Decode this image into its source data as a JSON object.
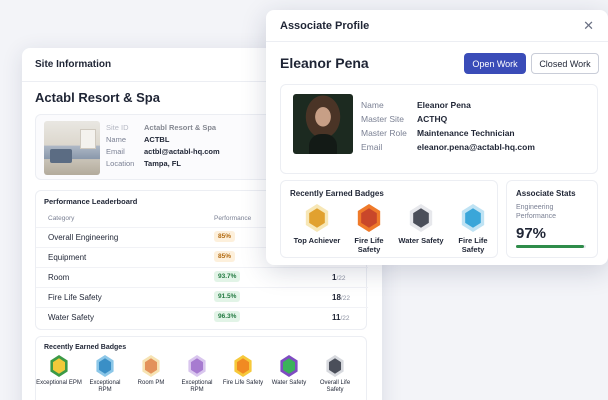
{
  "site": {
    "header": "Site Information",
    "title": "Actabl Resort & Spa",
    "info": [
      {
        "key": "Site ID",
        "value": "Actabl Resort & Spa"
      },
      {
        "key": "Name",
        "value": "ACTBL"
      },
      {
        "key": "Email",
        "value": "actbl@actabl-hq.com"
      },
      {
        "key": "Location",
        "value": "Tampa, FL"
      }
    ],
    "leaderboard": {
      "title": "Performance Leaderboard",
      "col_category": "Category",
      "col_performance": "Performance",
      "rows": [
        {
          "category": "Overall Engineering",
          "performance": "85%",
          "status": "amber",
          "rank": "",
          "total": ""
        },
        {
          "category": "Equipment",
          "performance": "85%",
          "status": "amber",
          "rank": "",
          "total": ""
        },
        {
          "category": "Room",
          "performance": "93.7%",
          "status": "green",
          "rank": "1",
          "total": "/22"
        },
        {
          "category": "Fire Life Safety",
          "performance": "91.5%",
          "status": "green",
          "rank": "18",
          "total": "/22"
        },
        {
          "category": "Water Safety",
          "performance": "96.3%",
          "status": "green",
          "rank": "11",
          "total": "/22"
        }
      ]
    },
    "badges": {
      "title": "Recently Earned Badges",
      "items": [
        {
          "label": "Exceptional EPM",
          "icon": "gear-badge-icon",
          "color": "#3c9a46",
          "inner": "#f1c93a"
        },
        {
          "label": "Exceptional RPM",
          "icon": "gem-badge-icon",
          "color": "#8cc7e8",
          "inner": "#3a8fc6"
        },
        {
          "label": "Room PM",
          "icon": "room-badge-icon",
          "color": "#f6e3b3",
          "inner": "#e3925b"
        },
        {
          "label": "Exceptional RPM",
          "icon": "cake-badge-icon",
          "color": "#d9c6ee",
          "inner": "#a77bd0"
        },
        {
          "label": "Fire Life Safety",
          "icon": "flame-badge-icon",
          "color": "#f6c93b",
          "inner": "#f18a22"
        },
        {
          "label": "Water Safety",
          "icon": "check-badge-icon",
          "color": "#7f4cc2",
          "inner": "#3bb25a"
        },
        {
          "label": "Overall Life Safety",
          "icon": "bee-badge-icon",
          "color": "#d7d9de",
          "inner": "#4b4f5a"
        }
      ]
    }
  },
  "profile": {
    "header": "Associate Profile",
    "close_glyph": "✕",
    "name": "Eleanor Pena",
    "buttons": {
      "open_work": "Open Work",
      "closed_work": "Closed Work"
    },
    "info": [
      {
        "key": "Name",
        "value": "Eleanor Pena"
      },
      {
        "key": "Master Site",
        "value": "ACTHQ"
      },
      {
        "key": "Master Role",
        "value": "Maintenance Technician"
      },
      {
        "key": "Email",
        "value": "eleanor.pena@actabl-hq.com"
      }
    ],
    "badges": {
      "title": "Recently Earned Badges",
      "items": [
        {
          "label": "Top Achiever",
          "icon": "trophy-badge-icon",
          "color": "#f7e7b6",
          "inner": "#e1a12f"
        },
        {
          "label": "Fire Life Safety",
          "icon": "fire-badge-icon",
          "color": "#ef7a2a",
          "inner": "#c9472a"
        },
        {
          "label": "Water Safety",
          "icon": "bee-badge-icon",
          "color": "#e7e8ec",
          "inner": "#4b4f5a"
        },
        {
          "label": "Fire Life Safety",
          "icon": "diamond-badge-icon",
          "color": "#bfe3f4",
          "inner": "#3aa6d9"
        }
      ]
    },
    "stats": {
      "title": "Associate Stats",
      "label": "Engineering Performance",
      "value": "97%",
      "progress": 0.97,
      "bar_color": "#2f8c4a"
    }
  }
}
